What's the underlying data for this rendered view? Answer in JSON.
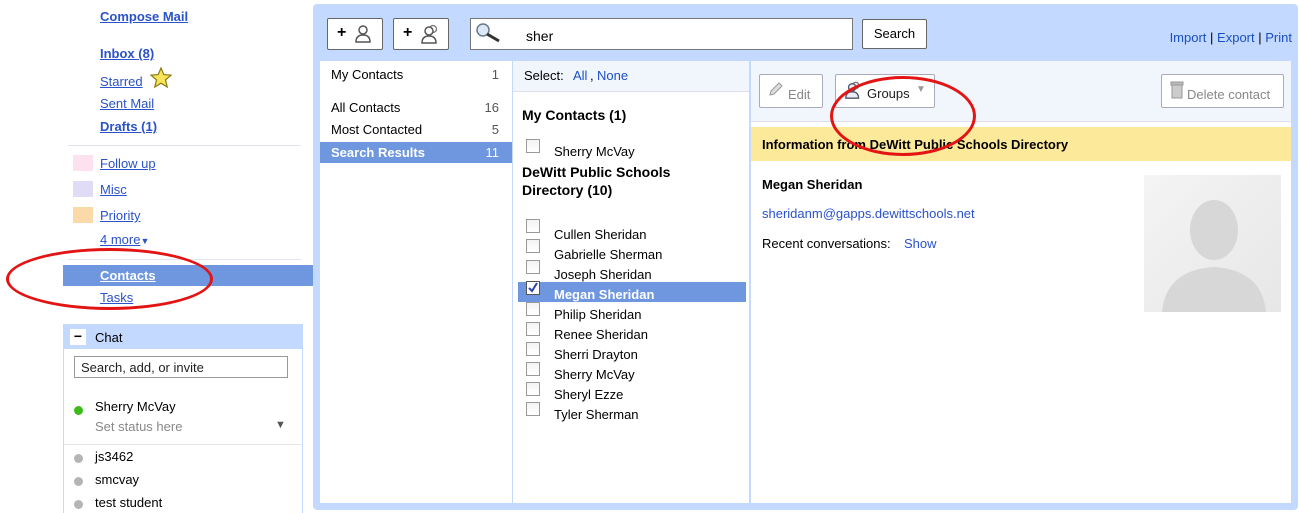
{
  "nav": {
    "compose": "Compose Mail",
    "inbox": "Inbox (8)",
    "starred": "Starred",
    "sent": "Sent Mail",
    "drafts": "Drafts (1)",
    "labels": [
      {
        "name": "Follow up",
        "color": "#fde1ef"
      },
      {
        "name": "Misc",
        "color": "#e0dcf5"
      },
      {
        "name": "Priority",
        "color": "#fbd9a8"
      }
    ],
    "more": "4 more",
    "contacts": "Contacts",
    "tasks": "Tasks"
  },
  "chat": {
    "title": "Chat",
    "search_value": "Search, add, or invite",
    "me": "Sherry McVay",
    "status": "Set status here",
    "buddies": [
      "js3462",
      "smcvay",
      "test student"
    ]
  },
  "toolbar": {
    "search_value": "sher",
    "search_button": "Search",
    "import": "Import",
    "export": "Export",
    "print": "Print",
    "sep": "|"
  },
  "groups": [
    {
      "name": "My Contacts",
      "count": "1"
    },
    {
      "name": "All Contacts",
      "count": "16"
    },
    {
      "name": "Most Contacted",
      "count": "5"
    },
    {
      "name": "Search Results",
      "count": "11"
    }
  ],
  "list": {
    "select_label": "Select:",
    "all": "All",
    "none": "None",
    "section1": "My Contacts (1)",
    "section1_items": [
      "Sherry McVay"
    ],
    "section2_line1": "DeWitt Public Schools",
    "section2_line2": "Directory (10)",
    "section2_items": [
      "Cullen Sheridan",
      "Gabrielle Sherman",
      "Joseph Sheridan",
      "Megan Sheridan",
      "Philip Sheridan",
      "Renee Sheridan",
      "Sherri Drayton",
      "Sherry McVay",
      "Sheryl Ezze",
      "Tyler Sherman"
    ]
  },
  "detail": {
    "edit": "Edit",
    "groups": "Groups",
    "delete": "Delete contact",
    "info_header": "Information from DeWitt Public Schools Directory",
    "name": "Megan Sheridan",
    "email": "sheridanm@gapps.dewittschools.net",
    "recent_label": "Recent conversations:",
    "show": "Show"
  }
}
